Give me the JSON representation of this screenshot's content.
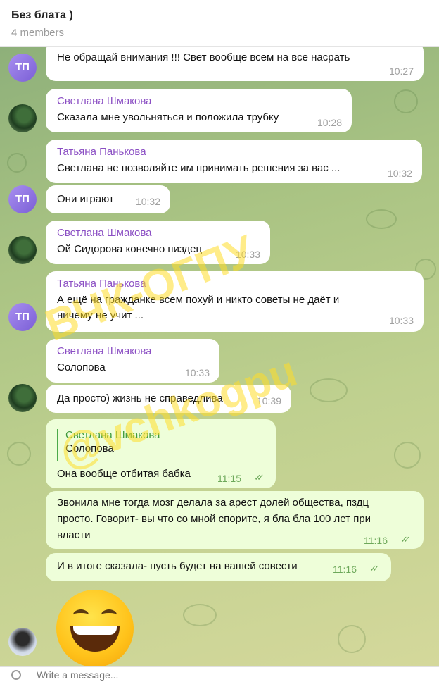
{
  "header": {
    "title": "Без блата )",
    "members": "4 members"
  },
  "avatars": {
    "tp": "ТП"
  },
  "messages": [
    {
      "text": "Не обращай внимания !!! Свет воoбще всем на все насрать",
      "time": "10:27"
    },
    {
      "sender": "Светлана Шмакова",
      "text": "Сказала мне увольняться и положила трубку",
      "time": "10:28"
    },
    {
      "sender": "Татьяна Панькова",
      "text": "Светлана не позволяйте им принимать решения за вас ...",
      "time": "10:32"
    },
    {
      "text": "Они играют",
      "time": "10:32"
    },
    {
      "sender": "Светлана Шмакова",
      "text": "Ой Сидорова конечно пиздец",
      "time": "10:33"
    },
    {
      "sender": "Татьяна Панькова",
      "text_line1": "А ещё на гражданке всем похуй и никто советы не даёт и",
      "text_line2": "ничему не учит ...",
      "time": "10:33"
    },
    {
      "sender": "Светлана Шмакова",
      "text": "Солопова",
      "time": "10:33"
    },
    {
      "text": "Да просто) жизнь не справедлива",
      "time": "10:39"
    },
    {
      "quote_sender": "Светлана Шмакова",
      "quote_text": "Солопова",
      "text": "Она вообще отбитая бабка",
      "time": "11:15"
    },
    {
      "text_line1": "Звонила мне тогда мозг делала за арест долей общества, пздц",
      "text_line2": "просто. Говорит- вы что со мной спорите, я бла бла 100 лет при",
      "text_line3": "власти",
      "time": "11:16"
    },
    {
      "text": "И в итоге сказала- пусть будет на вашей совести",
      "time": "11:16"
    }
  ],
  "watermark": {
    "line1": "ВЧК-ОГПУ",
    "line2": "@vchkogpu"
  },
  "composer": {
    "placeholder": "Write a message..."
  },
  "colors": {
    "accent_purple": "#8b4fc4",
    "accent_green": "#3f9a3b",
    "outgoing_bubble": "#eefed9",
    "watermark": "#ffdc28"
  },
  "icons": [
    "double-check-icon",
    "attach-icon",
    "laughing-emoji"
  ]
}
